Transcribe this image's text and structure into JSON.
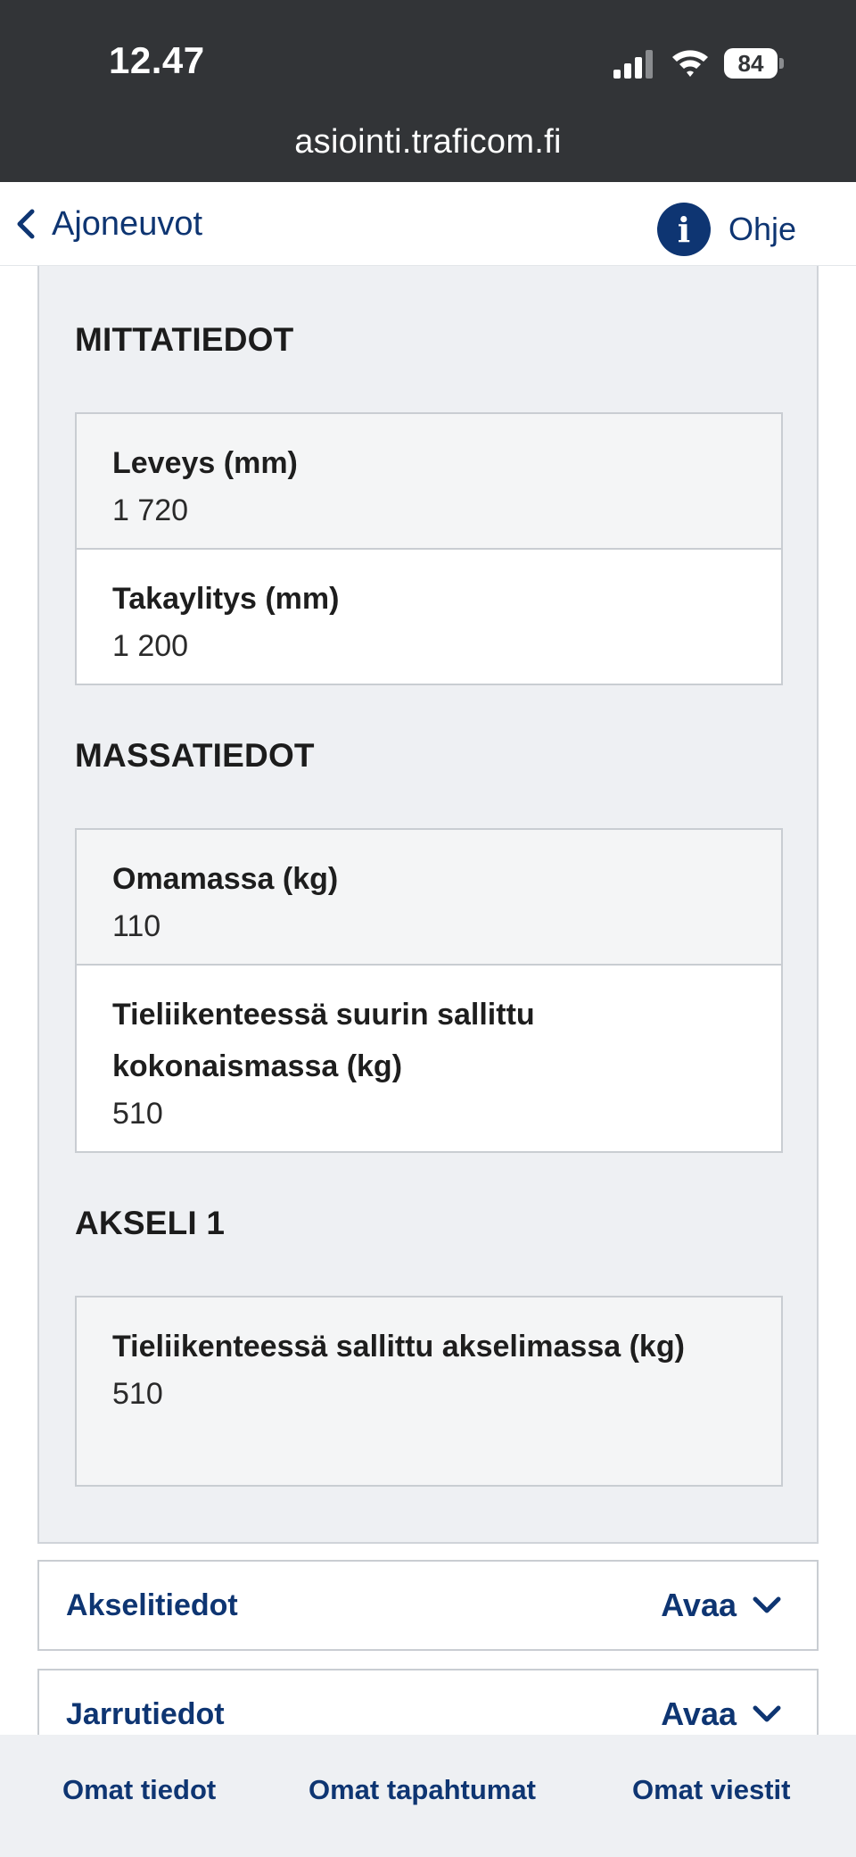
{
  "status_bar": {
    "time": "12.47",
    "battery": "84",
    "url": "asiointi.traficom.fi"
  },
  "top_nav": {
    "back_label": "Ajoneuvot",
    "help_icon_glyph": "i",
    "help_label": "Ohje"
  },
  "sections": [
    {
      "title": "MITTATIEDOT",
      "rows": [
        {
          "label": "Leveys (mm)",
          "value": "1 720"
        },
        {
          "label": "Takaylitys (mm)",
          "value": "1 200"
        }
      ]
    },
    {
      "title": "MASSATIEDOT",
      "rows": [
        {
          "label": "Omamassa (kg)",
          "value": "110"
        },
        {
          "label": "Tieliikenteessä suurin sallittu kokonaismassa (kg)",
          "value": "510"
        }
      ]
    },
    {
      "title": "AKSELI 1",
      "rows": [
        {
          "label": "Tieliikenteessä sallittu akselimassa (kg)",
          "value": "510"
        }
      ]
    }
  ],
  "accordions": [
    {
      "title": "Akselitiedot",
      "action": "Avaa"
    },
    {
      "title": "Jarrutiedot",
      "action": "Avaa"
    }
  ],
  "bottom_nav": {
    "items": [
      "Omat tiedot",
      "Omat tapahtumat",
      "Omat viestit"
    ]
  },
  "colors": {
    "status_bar_bg": "#323437",
    "brand_navy": "#0e3572",
    "panel_bg": "#eef0f3",
    "border": "#c9cdd2"
  },
  "icons": {
    "back": "chevron-left-icon",
    "help": "info-icon",
    "expand": "chevron-down-icon"
  }
}
